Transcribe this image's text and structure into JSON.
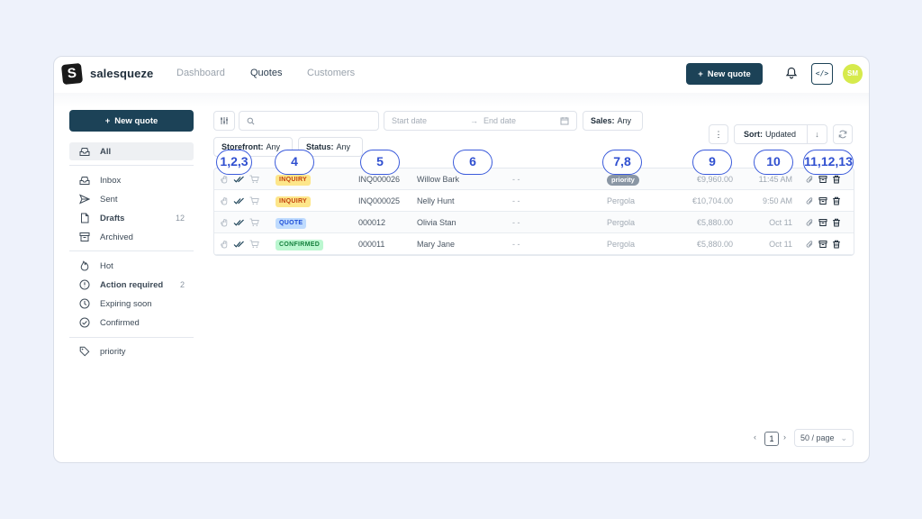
{
  "app": {
    "brand": "salesqueze",
    "logo_letter": "S",
    "nav": [
      "Dashboard",
      "Quotes",
      "Customers"
    ],
    "active_nav": "Quotes",
    "new_quote_label": "New quote",
    "code_icon_label": "</>",
    "avatar_initials": "SM"
  },
  "sidebar": {
    "new_quote_label": "New quote",
    "items": [
      {
        "label": "All",
        "icon": "inbox-stack-icon",
        "active": true
      },
      {
        "label": "Inbox",
        "icon": "inbox-icon"
      },
      {
        "label": "Sent",
        "icon": "send-icon"
      },
      {
        "label": "Drafts",
        "icon": "file-icon",
        "count": "12",
        "bold": true
      },
      {
        "label": "Archived",
        "icon": "archive-icon"
      },
      {
        "label": "Hot",
        "icon": "flame-icon"
      },
      {
        "label": "Action required",
        "icon": "alert-circle-icon",
        "count": "2",
        "bold": true
      },
      {
        "label": "Expiring soon",
        "icon": "clock-icon"
      },
      {
        "label": "Confirmed",
        "icon": "check-circle-icon"
      },
      {
        "label": "priority",
        "icon": "tag-icon"
      }
    ]
  },
  "filters": {
    "search_placeholder": "",
    "start_date_placeholder": "Start date",
    "end_date_placeholder": "End date",
    "date_arrow": "→",
    "sales_label": "Sales:",
    "sales_value": "Any",
    "storefront_label": "Storefront:",
    "storefront_value": "Any",
    "status_label": "Status:",
    "status_value": "Any",
    "more_icon": "⋮",
    "sort_label": "Sort:",
    "sort_value": "Updated",
    "sort_dir_icon": "↓"
  },
  "annotations": [
    "1,2,3",
    "4",
    "5",
    "6",
    "7,8",
    "9",
    "10",
    "11,12,13"
  ],
  "rows": [
    {
      "status": "INQUIRY",
      "status_class": "b-inquiry",
      "number": "INQ000026",
      "customer": "Willow Bark",
      "placeholder": "- -",
      "tag": "priority",
      "tag_is_pill": true,
      "amount": "€9,960.00",
      "time": "11:45 AM"
    },
    {
      "status": "INQUIRY",
      "status_class": "b-inquiry",
      "number": "INQ000025",
      "customer": "Nelly Hunt",
      "placeholder": "- -",
      "tag": "Pergola",
      "tag_is_pill": false,
      "amount": "€10,704.00",
      "time": "9:50 AM"
    },
    {
      "status": "QUOTE",
      "status_class": "b-quote",
      "number": "000012",
      "customer": "Olivia Stan",
      "placeholder": "- -",
      "tag": "Pergola",
      "tag_is_pill": false,
      "amount": "€5,880.00",
      "time": "Oct 11"
    },
    {
      "status": "CONFIRMED",
      "status_class": "b-confirmed",
      "number": "000011",
      "customer": "Mary Jane",
      "placeholder": "- -",
      "tag": "Pergola",
      "tag_is_pill": false,
      "amount": "€5,880.00",
      "time": "Oct 11"
    }
  ],
  "pagination": {
    "prev": "‹",
    "current": "1",
    "next": "›",
    "per_page": "50 / page"
  },
  "colors": {
    "primary": "#1c4257",
    "accent_annotation": "#3b5bdb",
    "avatar": "#d6ea4c"
  }
}
